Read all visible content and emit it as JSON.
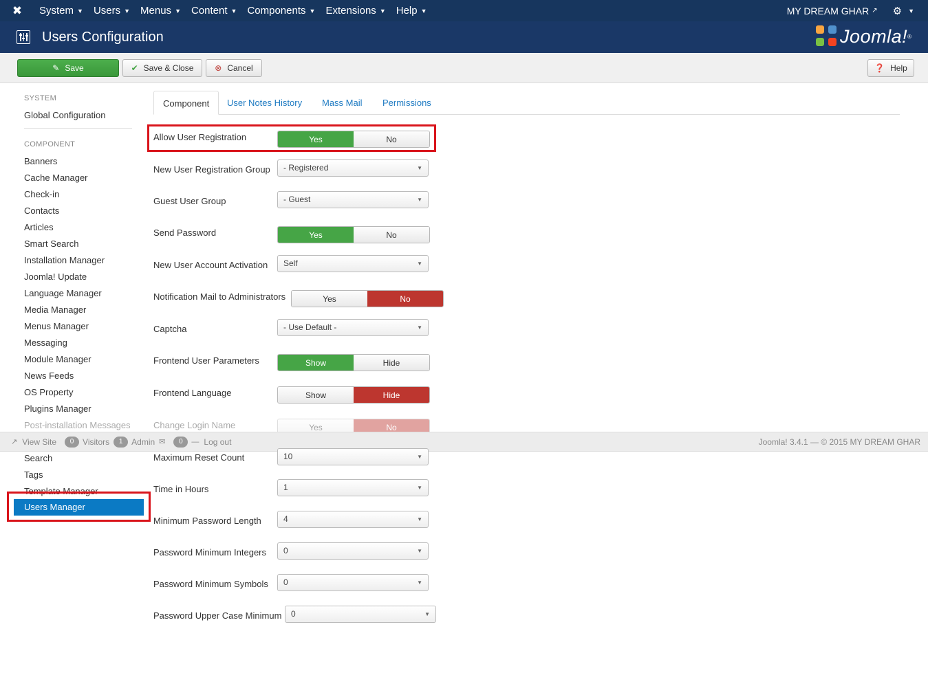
{
  "navbar": {
    "menu": [
      {
        "label": "System"
      },
      {
        "label": "Users"
      },
      {
        "label": "Menus"
      },
      {
        "label": "Content"
      },
      {
        "label": "Components"
      },
      {
        "label": "Extensions"
      },
      {
        "label": "Help"
      }
    ],
    "site_name": "MY DREAM GHAR"
  },
  "header": {
    "title": "Users Configuration",
    "brand": "Joomla!"
  },
  "toolbar": {
    "save_label": "Save",
    "save_close_label": "Save & Close",
    "cancel_label": "Cancel",
    "help_label": "Help"
  },
  "sidebar": {
    "system_heading": "SYSTEM",
    "global_config": "Global Configuration",
    "component_heading": "COMPONENT",
    "items": [
      "Banners",
      "Cache Manager",
      "Check-in",
      "Contacts",
      "Articles",
      "Smart Search",
      "Installation Manager",
      "Joomla! Update",
      "Language Manager",
      "Media Manager",
      "Menus Manager",
      "Messaging",
      "Module Manager",
      "News Feeds",
      "OS Property",
      "Plugins Manager",
      "Post-installation Messages"
    ],
    "items_below": [
      "Search",
      "Tags",
      "Template Manager"
    ],
    "active": "Users Manager"
  },
  "tabs": [
    "Component",
    "User Notes History",
    "Mass Mail",
    "Permissions"
  ],
  "form": {
    "allow_registration": {
      "label": "Allow User Registration",
      "yes": "Yes",
      "no": "No",
      "value": "Yes"
    },
    "registration_group": {
      "label": "New User Registration Group",
      "value": "- Registered"
    },
    "guest_group": {
      "label": "Guest User Group",
      "value": "- Guest"
    },
    "send_password": {
      "label": "Send Password",
      "yes": "Yes",
      "no": "No",
      "value": "Yes"
    },
    "account_activation": {
      "label": "New User Account Activation",
      "value": "Self"
    },
    "notification_mail": {
      "label": "Notification Mail to Administrators",
      "yes": "Yes",
      "no": "No",
      "value": "No"
    },
    "captcha": {
      "label": "Captcha",
      "value": "- Use Default -"
    },
    "frontend_params": {
      "label": "Frontend User Parameters",
      "show": "Show",
      "hide": "Hide",
      "value": "Show"
    },
    "frontend_language": {
      "label": "Frontend Language",
      "show": "Show",
      "hide": "Hide",
      "value": "Hide"
    },
    "change_login": {
      "label": "Change Login Name",
      "yes": "Yes",
      "no": "No",
      "value": "No"
    },
    "max_reset": {
      "label": "Maximum Reset Count",
      "value": "10"
    },
    "time_hours": {
      "label": "Time in Hours",
      "value": "1"
    },
    "min_pw_length": {
      "label": "Minimum Password Length",
      "value": "4"
    },
    "pw_min_integers": {
      "label": "Password Minimum Integers",
      "value": "0"
    },
    "pw_min_symbols": {
      "label": "Password Minimum Symbols",
      "value": "0"
    },
    "pw_upper_min": {
      "label": "Password Upper Case Minimum",
      "value": "0"
    }
  },
  "statusbar": {
    "view_site": "View Site",
    "visitors_count": "0",
    "visitors_label": "Visitors",
    "admin_count": "1",
    "admin_label": "Admin",
    "messages_count": "0",
    "logout": "Log out",
    "version": "Joomla! 3.4.1 — © 2015 MY DREAM GHAR"
  },
  "colors": {
    "navbar": "#17365e",
    "header": "#1a3867",
    "green": "#46a546",
    "red": "#bd362f",
    "active_blue": "#0b7ac4",
    "highlight_red": "#d9141b"
  }
}
